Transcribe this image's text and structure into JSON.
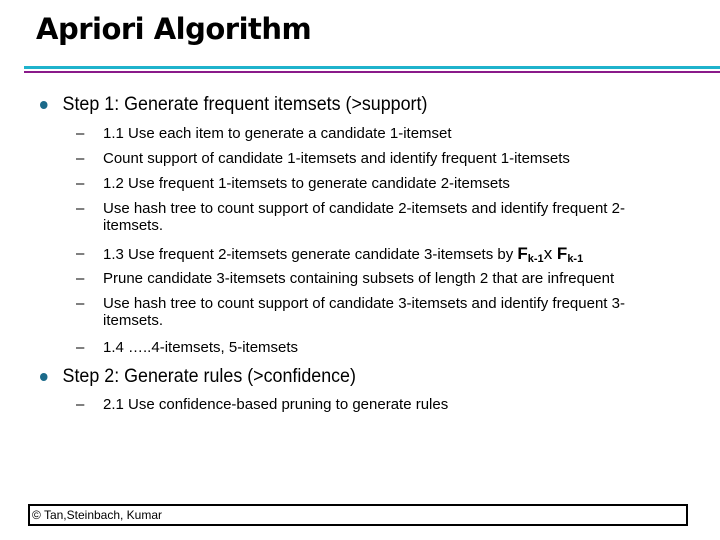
{
  "slide": {
    "title": "Apriori Algorithm",
    "accent_colors": {
      "rule_top": "#1fb3cc",
      "rule_bottom": "#8a1a8a",
      "bullet": "#1b6a8a"
    },
    "steps": [
      {
        "label": "Step 1: Generate frequent itemsets (>support)",
        "subitems": [
          "1.1 Use each item to generate a candidate 1-itemset",
          "Count support of candidate 1-itemsets and identify frequent 1-itemsets",
          "1.2 Use frequent 1-itemsets to generate candidate 2-itemsets",
          "Use hash tree to count support of candidate 2-itemsets and identify frequent 2-itemsets.",
          "1.3  Use frequent 2-itemsets generate candidate 3-itemsets by ",
          "Prune candidate 3-itemsets containing subsets of length 2 that are infrequent",
          "Use  hash tree to count support of candidate 3-itemsets and identify frequent 3-itemsets.",
          "1.4 …..4-itemsets, 5-itemsets"
        ],
        "formula": {
          "f": "F",
          "sub": "k-1",
          "times": "x"
        }
      },
      {
        "label": "Step 2: Generate rules (>confidence)",
        "subitems": [
          "2.1 Use confidence-based pruning to generate rules"
        ]
      }
    ],
    "dash": "–",
    "footer": "© Tan,Steinbach, Kumar"
  }
}
